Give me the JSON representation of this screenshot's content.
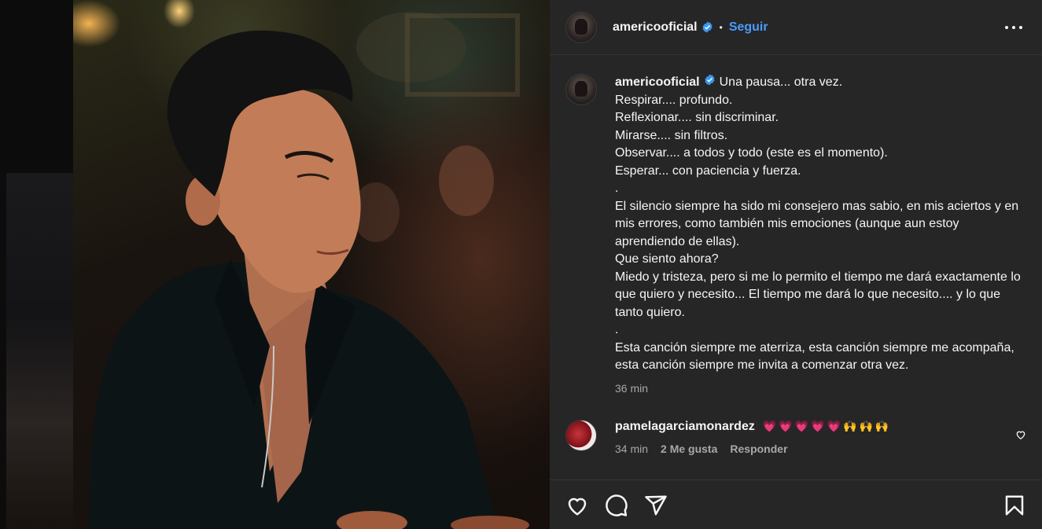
{
  "post": {
    "username": "americooficial",
    "follow_label": "Seguir",
    "separator": "•",
    "caption_lines": [
      "Una pausa... otra vez.",
      "Respirar.... profundo.",
      "Reflexionar.... sin discriminar.",
      "Mirarse.... sin filtros.",
      "Observar.... a todos y todo (este es el momento).",
      "Esperar... con paciencia y fuerza.",
      ".",
      "El silencio siempre ha sido mi consejero mas sabio, en mis aciertos y en mis errores, como también mis emociones (aunque aun estoy aprendiendo de ellas).",
      "Que siento ahora?",
      "Miedo y tristeza, pero si me lo permito el tiempo me dará exactamente lo que quiero y necesito... El tiempo me dará lo que necesito.... y lo que tanto quiero.",
      ".",
      "Esta canción siempre me aterriza, esta canción siempre me acompaña, esta canción siempre me invita a comenzar otra vez."
    ],
    "time": "36 min"
  },
  "comment": {
    "username": "pamelagarciamonardez",
    "emoji_hearts": "💗💗💗💗💗",
    "emoji_hands": "🙌🙌🙌",
    "time": "34 min",
    "likes": "2 Me gusta",
    "reply": "Responder"
  },
  "icons": [
    "verified-badge-icon",
    "more-options-icon",
    "heart-icon",
    "comment-icon",
    "share-icon",
    "bookmark-icon",
    "small-heart-icon"
  ],
  "colors": {
    "panel_bg": "#262626",
    "link_blue": "#4a9bff",
    "muted": "#a8a8a8",
    "verified": "#3897f0"
  }
}
